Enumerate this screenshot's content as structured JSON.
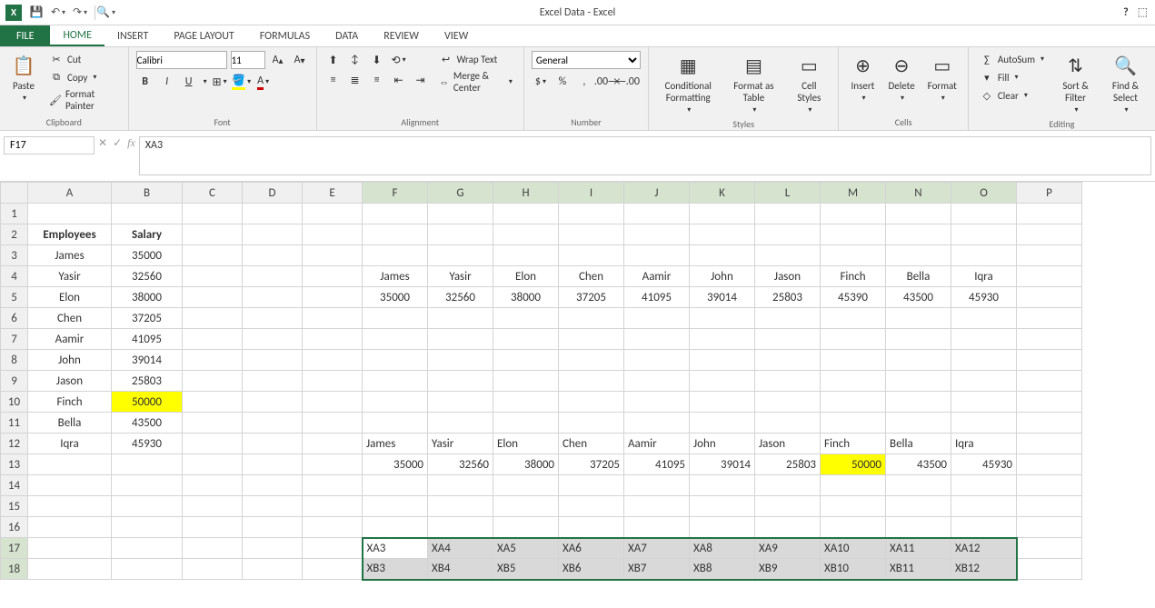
{
  "title": "Excel Data - Excel",
  "qat": {
    "save_tip": "Save",
    "undo_tip": "Undo",
    "redo_tip": "Redo",
    "preview_tip": "Print Preview"
  },
  "tabs": {
    "file": "FILE",
    "home": "HOME",
    "insert": "INSERT",
    "pagelayout": "PAGE LAYOUT",
    "formulas": "FORMULAS",
    "data": "DATA",
    "review": "REVIEW",
    "view": "VIEW"
  },
  "ribbon": {
    "clipboard": {
      "paste": "Paste",
      "cut": "Cut",
      "copy": "Copy",
      "painter": "Format Painter",
      "label": "Clipboard"
    },
    "font": {
      "name": "Calibri",
      "size": "11",
      "bold": "B",
      "italic": "I",
      "underline": "U",
      "label": "Font"
    },
    "alignment": {
      "wrap": "Wrap Text",
      "merge": "Merge & Center",
      "label": "Alignment"
    },
    "number": {
      "format": "General",
      "label": "Number"
    },
    "styles": {
      "cond": "Conditional Formatting",
      "table": "Format as Table",
      "cell": "Cell Styles",
      "label": "Styles"
    },
    "cells": {
      "insert": "Insert",
      "delete": "Delete",
      "format": "Format",
      "label": "Cells"
    },
    "editing": {
      "autosum": "AutoSum",
      "fill": "Fill",
      "clear": "Clear",
      "sort": "Sort & Filter",
      "find": "Find & Select",
      "label": "Editing"
    }
  },
  "formula_bar": {
    "name_box": "F17",
    "fx": "fx",
    "formula": "XA3"
  },
  "headers": {
    "cols": [
      "A",
      "B",
      "C",
      "D",
      "E",
      "F",
      "G",
      "H",
      "I",
      "J",
      "K",
      "L",
      "M",
      "N",
      "O",
      "P"
    ]
  },
  "sheet": {
    "A2": "Employees",
    "B2": "Salary",
    "employees": [
      "James",
      "Yasir",
      "Elon",
      "Chen",
      "Aamir",
      "John",
      "Jason",
      "Finch",
      "Bella",
      "Iqra"
    ],
    "salaries": [
      "35000",
      "32560",
      "38000",
      "37205",
      "41095",
      "39014",
      "25803",
      "50000",
      "43500",
      "45930"
    ],
    "row4_names": [
      "James",
      "Yasir",
      "Elon",
      "Chen",
      "Aamir",
      "John",
      "Jason",
      "Finch",
      "Bella",
      "Iqra"
    ],
    "row5_vals": [
      "35000",
      "32560",
      "38000",
      "37205",
      "41095",
      "39014",
      "25803",
      "45390",
      "43500",
      "45930"
    ],
    "row12_names": [
      "James",
      "Yasir",
      "Elon",
      "Chen",
      "Aamir",
      "John",
      "Jason",
      "Finch",
      "Bella",
      "Iqra"
    ],
    "row13_vals": [
      "35000",
      "32560",
      "38000",
      "37205",
      "41095",
      "39014",
      "25803",
      "50000",
      "43500",
      "45930"
    ],
    "row17": [
      "XA3",
      "XA4",
      "XA5",
      "XA6",
      "XA7",
      "XA8",
      "XA9",
      "XA10",
      "XA11",
      "XA12"
    ],
    "row18": [
      "XB3",
      "XB4",
      "XB5",
      "XB6",
      "XB7",
      "XB8",
      "XB9",
      "XB10",
      "XB11",
      "XB12"
    ]
  }
}
